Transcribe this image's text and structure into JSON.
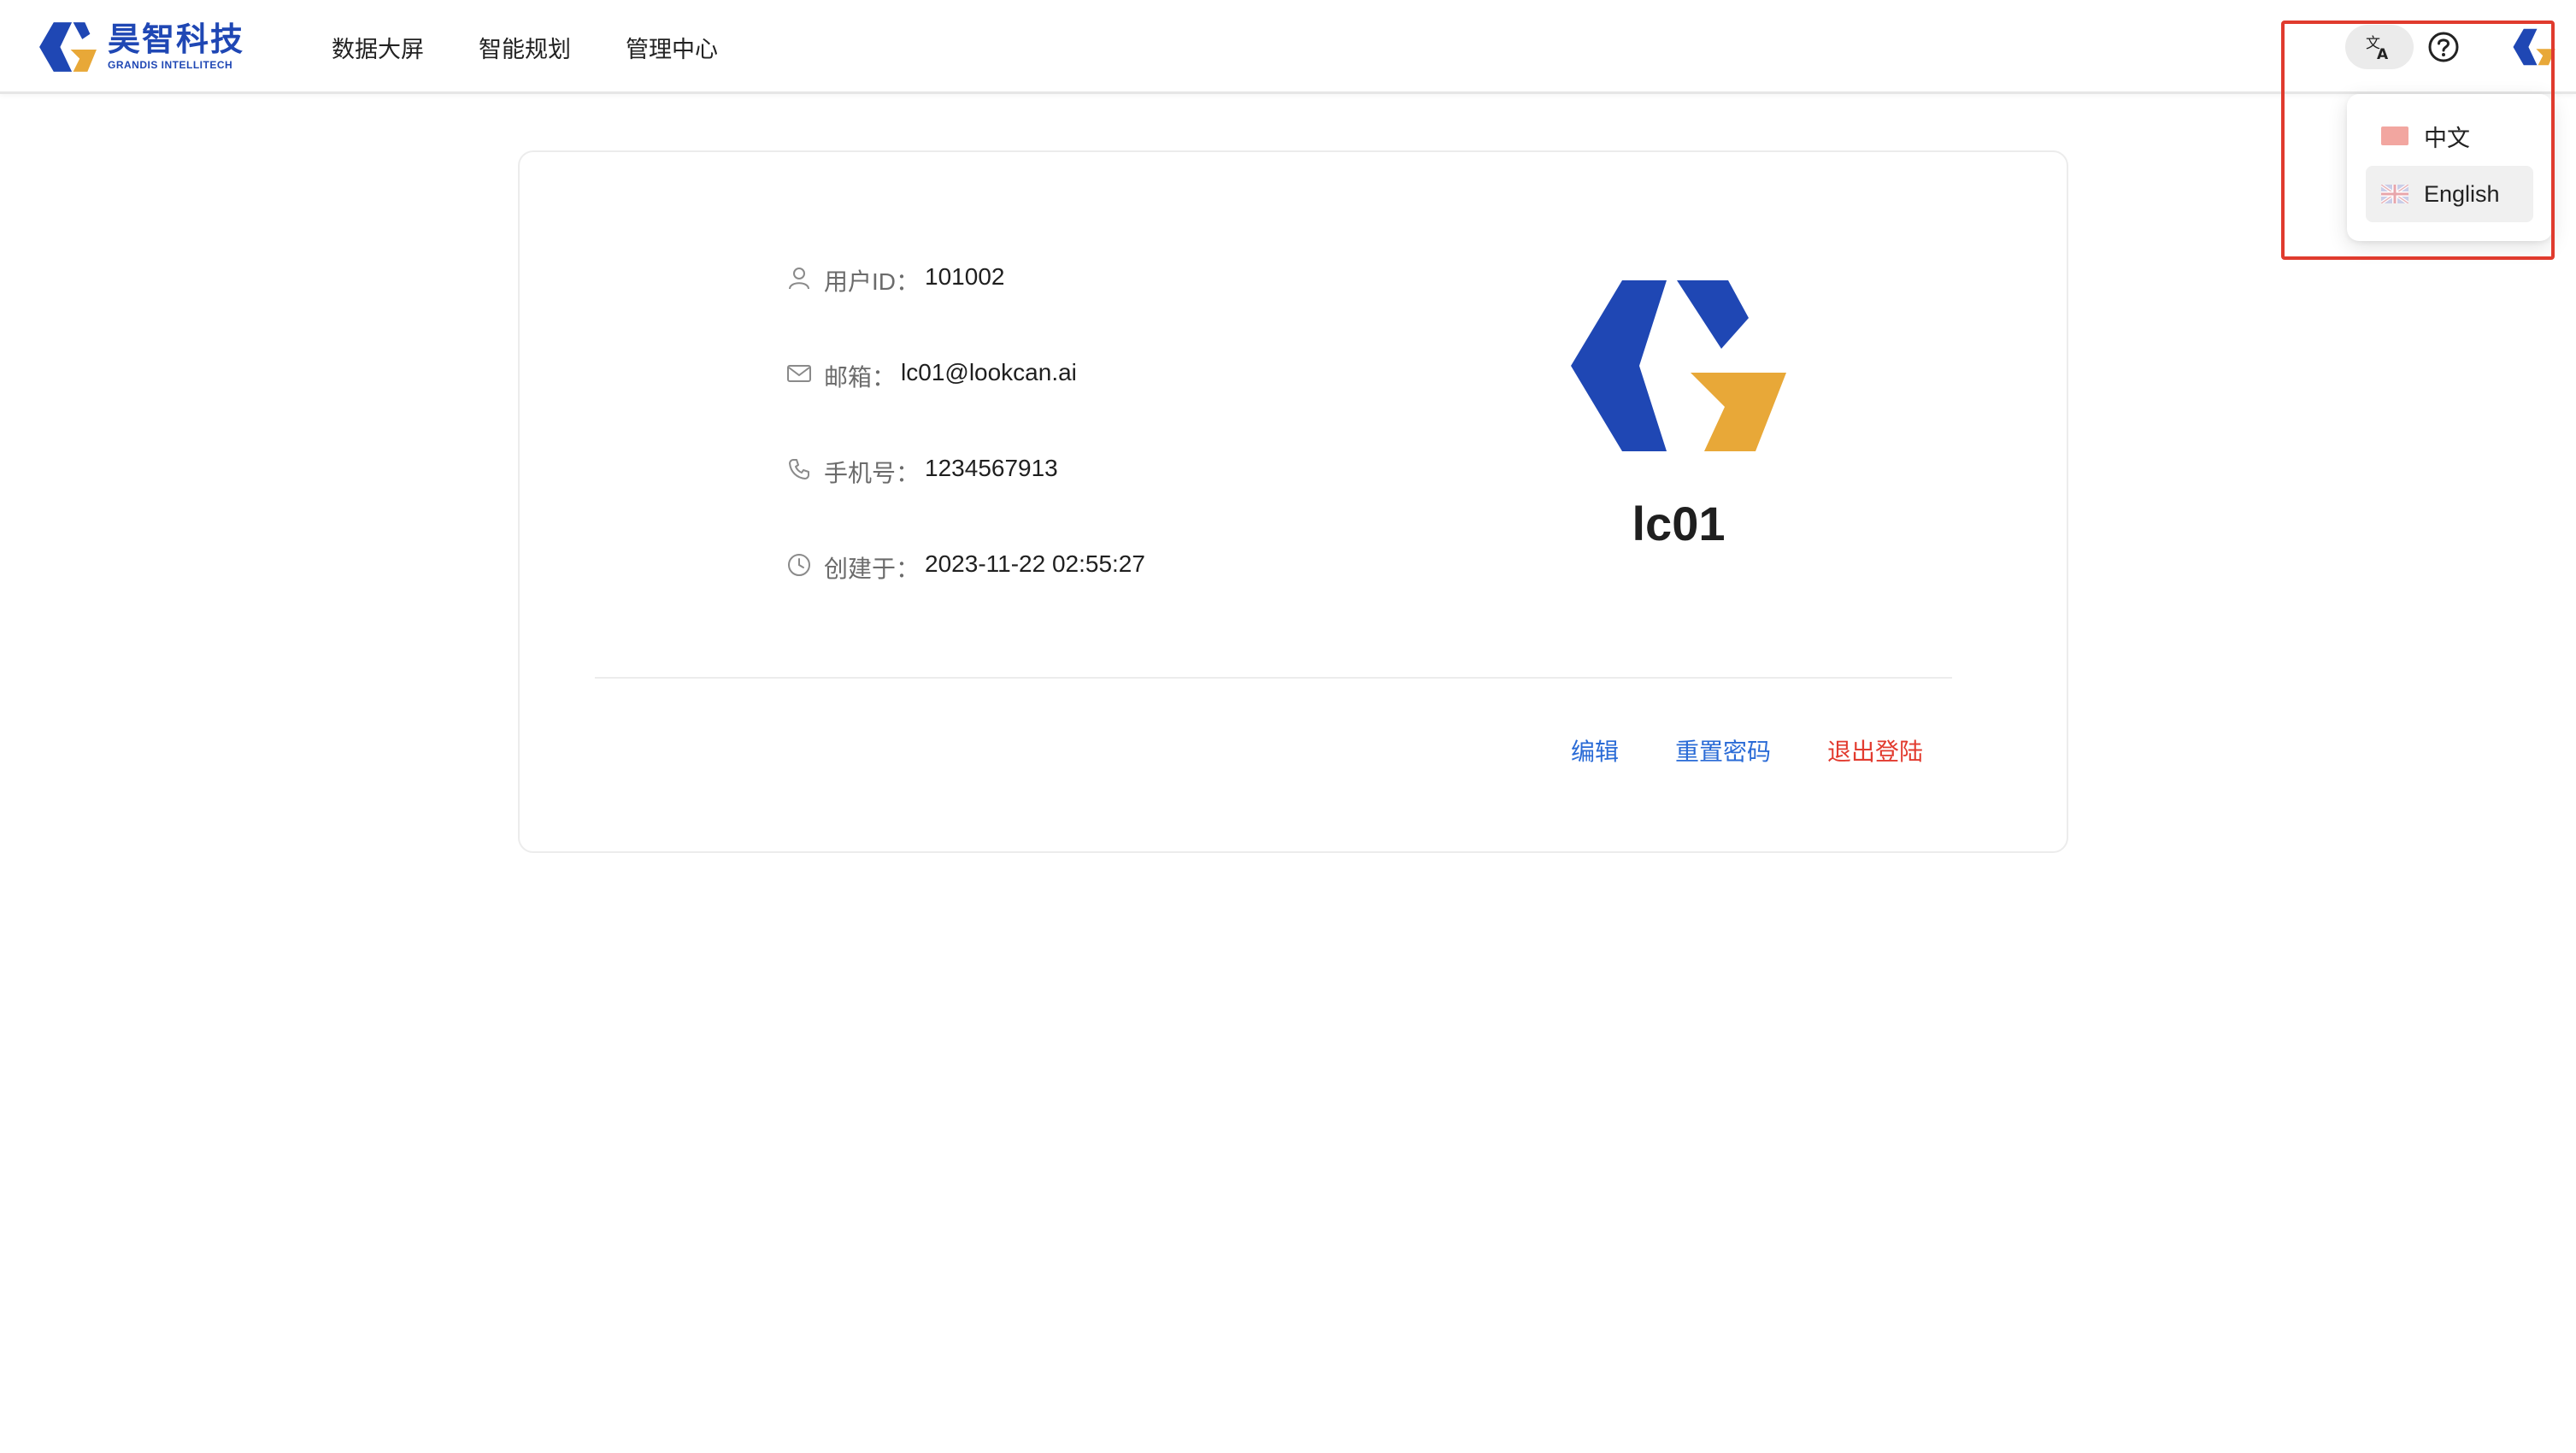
{
  "brand": {
    "name_cn": "昊智科技",
    "name_en": "GRANDIS INTELLITECH",
    "colors": {
      "blue": "#1f47b4",
      "gold": "#e8a838"
    }
  },
  "nav": {
    "items": [
      {
        "label": "数据大屏"
      },
      {
        "label": "智能规划"
      },
      {
        "label": "管理中心"
      }
    ]
  },
  "header_actions": {
    "language_icon": "translate-icon",
    "help_icon": "question-circle-icon",
    "avatar_icon": "brand-logo-icon"
  },
  "language_menu": {
    "options": [
      {
        "label": "中文",
        "flag": "china-flag-icon",
        "active": false
      },
      {
        "label": "English",
        "flag": "uk-flag-icon",
        "active": true
      }
    ]
  },
  "profile": {
    "user_id": {
      "label": "用户ID",
      "value": "101002"
    },
    "email": {
      "label": "邮箱",
      "value": "lc01@lookcan.ai"
    },
    "phone": {
      "label": "手机号",
      "value": "1234567913"
    },
    "created": {
      "label": "创建于",
      "value": "2023-11-22 02:55:27"
    },
    "colon": "：",
    "username": "lc01"
  },
  "actions": {
    "edit": "编辑",
    "reset_password": "重置密码",
    "logout": "退出登陆"
  },
  "colors": {
    "link": "#2a6bd6",
    "danger": "#e23b2f",
    "highlight": "#e03b2e"
  }
}
